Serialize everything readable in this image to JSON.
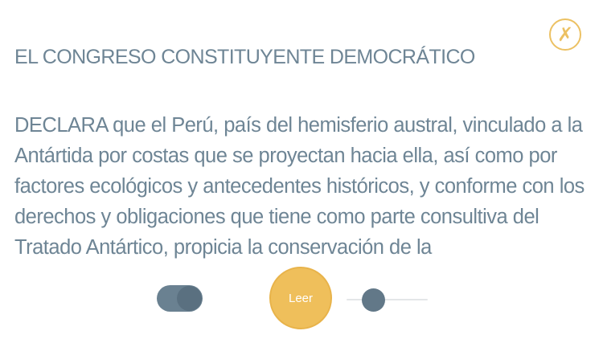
{
  "close_button": {
    "icon": "close-icon",
    "glyph": "✗"
  },
  "header": {
    "title": "EL CONGRESO CONSTITUYENTE DEMOCRÁTICO"
  },
  "content": {
    "body": "DECLARA que el Perú, país del hemisferio austral, vinculado a la Antártida por costas que se proyectan hacia ella, así como por factores ecológicos y antecedentes históricos, y conforme con los derechos y obligaciones que tiene como parte consultiva del Tratado Antártico, propicia la conservación de la"
  },
  "controls": {
    "toggle_on": true,
    "read_button_label": "Leer",
    "slider_value": 0.33
  },
  "colors": {
    "accent": "#ecc163",
    "text": "#6e8595",
    "toggle": "#6a8191",
    "slider_thumb": "#627888"
  }
}
